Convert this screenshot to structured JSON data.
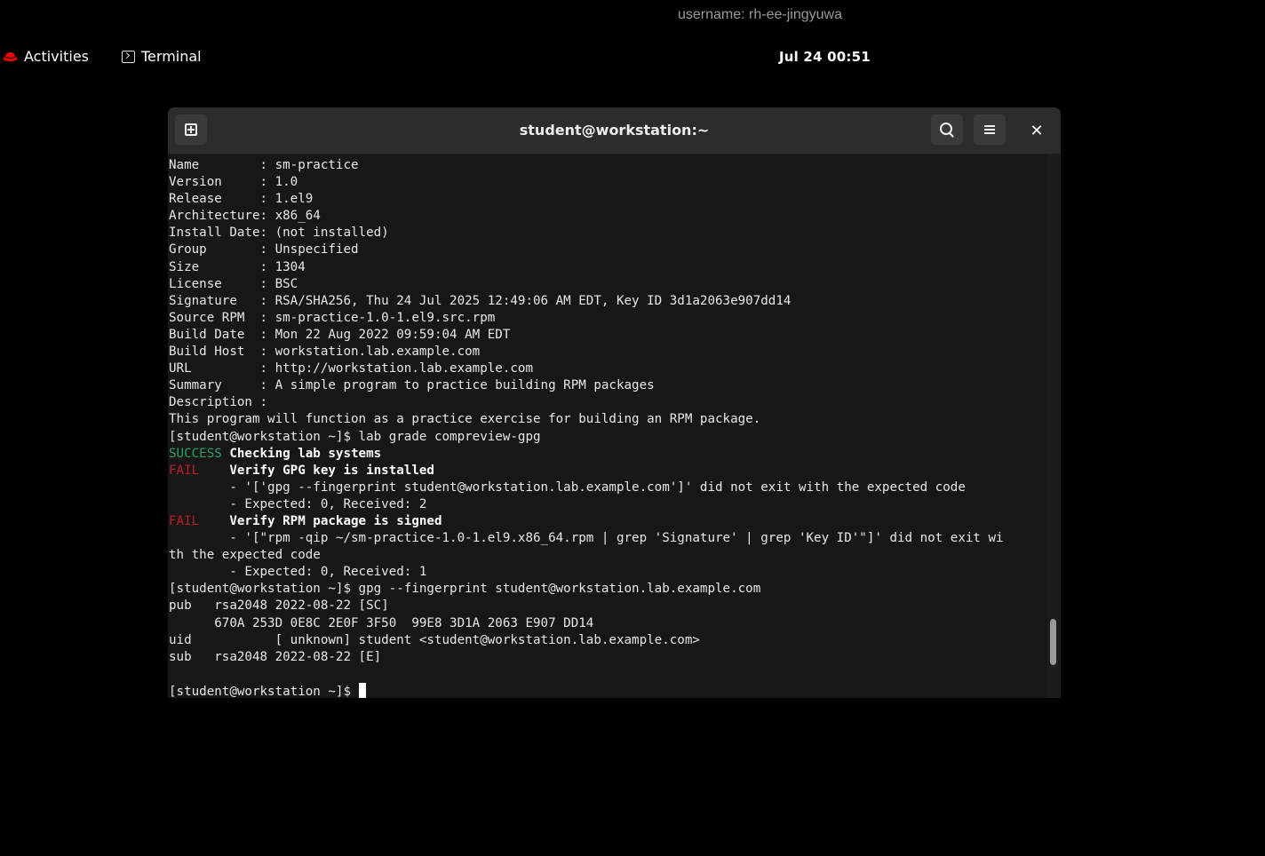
{
  "overlay": {
    "username": "username: rh-ee-jingyuwa"
  },
  "topbar": {
    "activities_label": "Activities",
    "app_label": "Terminal",
    "clock": "Jul 24  00:51"
  },
  "window": {
    "title": "student@workstation:~",
    "buttons": [
      "new-tab-icon",
      "search-icon",
      "hamburger-icon",
      "close-icon"
    ],
    "close_glyph": "✕"
  },
  "colors": {
    "success": "#26a269",
    "fail": "#c01c28",
    "brand_red": "#ee0000",
    "terminal_bg": "#171717"
  },
  "scrollbar": {
    "position": 0.94,
    "visible_fraction": 0.085
  },
  "terminal": {
    "lines": [
      [
        {
          "t": "Name        : sm-practice"
        }
      ],
      [
        {
          "t": "Version     : 1.0"
        }
      ],
      [
        {
          "t": "Release     : 1.el9"
        }
      ],
      [
        {
          "t": "Architecture: x86_64"
        }
      ],
      [
        {
          "t": "Install Date: (not installed)"
        }
      ],
      [
        {
          "t": "Group       : Unspecified"
        }
      ],
      [
        {
          "t": "Size        : 1304"
        }
      ],
      [
        {
          "t": "License     : BSC"
        }
      ],
      [
        {
          "t": "Signature   : RSA/SHA256, Thu 24 Jul 2025 12:49:06 AM EDT, Key ID 3d1a2063e907dd14"
        }
      ],
      [
        {
          "t": "Source RPM  : sm-practice-1.0-1.el9.src.rpm"
        }
      ],
      [
        {
          "t": "Build Date  : Mon 22 Aug 2022 09:59:04 AM EDT"
        }
      ],
      [
        {
          "t": "Build Host  : workstation.lab.example.com"
        }
      ],
      [
        {
          "t": "URL         : http://workstation.lab.example.com"
        }
      ],
      [
        {
          "t": "Summary     : A simple program to practice building RPM packages"
        }
      ],
      [
        {
          "t": "Description :"
        }
      ],
      [
        {
          "t": "This program will function as a practice exercise for building an RPM package."
        }
      ],
      [
        {
          "t": "[student@workstation ~]$ lab grade compreview-gpg"
        }
      ],
      [
        {
          "t": "SUCCESS",
          "s": "ok"
        },
        {
          "t": " "
        },
        {
          "t": "Checking lab systems",
          "s": "bold"
        }
      ],
      [
        {
          "t": "FAIL",
          "s": "fail"
        },
        {
          "t": "    "
        },
        {
          "t": "Verify GPG key is installed",
          "s": "bold"
        }
      ],
      [
        {
          "t": "        - '['gpg --fingerprint student@workstation.lab.example.com']' did not exit with the expected code"
        }
      ],
      [
        {
          "t": "        - Expected: 0, Received: 2"
        }
      ],
      [
        {
          "t": "FAIL",
          "s": "fail"
        },
        {
          "t": "    "
        },
        {
          "t": "Verify RPM package is signed",
          "s": "bold"
        }
      ],
      [
        {
          "t": "        - '[\"rpm -qip ~/sm-practice-1.0-1.el9.x86_64.rpm | grep 'Signature' | grep 'Key ID'\"]' did not exit wi"
        }
      ],
      [
        {
          "t": "th the expected code"
        }
      ],
      [
        {
          "t": "        - Expected: 0, Received: 1"
        }
      ],
      [
        {
          "t": "[student@workstation ~]$ gpg --fingerprint student@workstation.lab.example.com"
        }
      ],
      [
        {
          "t": "pub   rsa2048 2022-08-22 [SC]"
        }
      ],
      [
        {
          "t": "      670A 253D 0E8C 2E0F 3F50  99E8 3D1A 2063 E907 DD14"
        }
      ],
      [
        {
          "t": "uid           [ unknown] student <student@workstation.lab.example.com>"
        }
      ],
      [
        {
          "t": "sub   rsa2048 2022-08-22 [E]"
        }
      ],
      [
        {
          "t": ""
        }
      ],
      [
        {
          "t": "[student@workstation ~]$ "
        },
        {
          "cursor": true
        }
      ]
    ]
  }
}
